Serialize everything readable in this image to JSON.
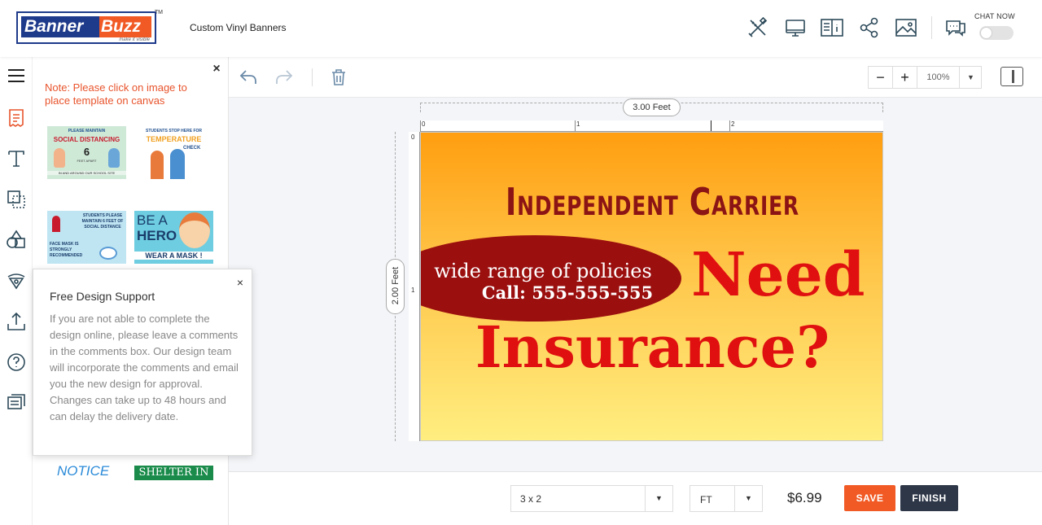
{
  "header": {
    "logo": {
      "part1": "Banner",
      "part2": "Buzz",
      "tagline": "make it visible",
      "trademark": "TM"
    },
    "page_title": "Custom Vinyl Banners",
    "icons": [
      "design-tools-icon",
      "preview-icon",
      "product-info-icon",
      "share-icon",
      "image-icon"
    ],
    "chat_label": "CHAT NOW",
    "chat_enabled": false
  },
  "rail": {
    "items": [
      "menu-icon",
      "templates-icon",
      "text-icon",
      "layers-icon",
      "shapes-icon",
      "clipart-icon",
      "upload-icon",
      "help-icon",
      "comments-icon"
    ]
  },
  "panel": {
    "close_label": "×",
    "note": "Note: Please click on image to place template on canvas",
    "templates": [
      {
        "line1": "PLEASE MAINTAIN",
        "line2": "SOCIAL DISTANCING",
        "line3": "6",
        "line4": "FEET APART",
        "line5": "IN AND AROUND OUR SCHOOL SITE"
      },
      {
        "line1": "STUDENTS STOP HERE FOR",
        "line2": "TEMPERATURE",
        "line3": "CHECK"
      },
      {
        "line1": "STUDENTS PLEASE MAINTAIN 6 FEET OF SOCIAL DISTANCE",
        "line2": "FACE MASK IS STRONGLY RECOMMENDED"
      },
      {
        "line1": "BE A",
        "line2": "HERO",
        "line3": "WEAR A MASK !"
      },
      {
        "line1": "NOTICE"
      },
      {
        "line1": "SHELTER IN"
      }
    ]
  },
  "popup": {
    "close_label": "×",
    "title": "Free Design Support",
    "body": "If you are not able to complete the design online, please leave a comments in the comments box. Our design team will incorporate the comments and email you the new design for approval. Changes can take up to 48 hours and can delay the delivery date."
  },
  "toolbar": {
    "zoom_out": "−",
    "zoom_in": "+",
    "zoom_value": "100%",
    "zoom_dropdown": "▼"
  },
  "canvas": {
    "width_label": "3.00 Feet",
    "height_label": "2.00 Feet",
    "ruler_h": [
      "0",
      "1",
      "2"
    ],
    "ruler_v": [
      "0",
      "1"
    ],
    "banner": {
      "title": "Independent Carrier",
      "oval_line1": "wide range of policies",
      "oval_line2": "Call: 555-555-555",
      "need": "Need",
      "insurance": "Insurance?"
    }
  },
  "bottom": {
    "size_value": "3 x 2",
    "unit_value": "FT",
    "dropdown": "▼",
    "price": "$6.99",
    "save_label": "SAVE",
    "finish_label": "FINISH"
  },
  "colors": {
    "brand_blue": "#1e3a8a",
    "brand_orange": "#f15a24",
    "finish_dark": "#2d3748",
    "banner_red": "#e01010",
    "banner_darkred": "#8b1414"
  }
}
